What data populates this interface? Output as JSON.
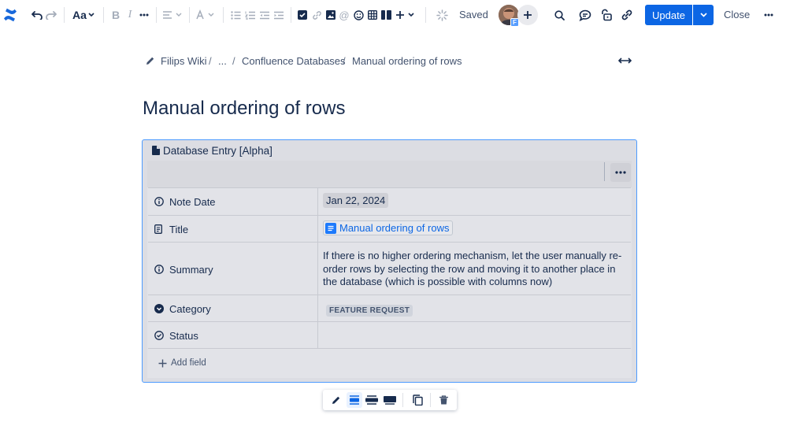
{
  "toolbar": {
    "text_style_label": "Aa",
    "saved_label": "Saved",
    "update_label": "Update",
    "close_label": "Close",
    "avatar_badge": "F"
  },
  "breadcrumb": {
    "items": [
      "Filips Wiki",
      "...",
      "Confluence Databases",
      "Manual ordering of rows"
    ]
  },
  "page": {
    "title": "Manual ordering of rows"
  },
  "database_entry": {
    "panel_title": "Database Entry [Alpha]",
    "rows": [
      {
        "label": "Note Date",
        "icon": "info-icon",
        "value": "Jan 22, 2024"
      },
      {
        "label": "Title",
        "icon": "page-icon",
        "value": "Manual ordering of rows"
      },
      {
        "label": "Summary",
        "icon": "info-icon",
        "value": "If there is no higher ordering mechanism, let the user manually re-order rows by selecting the row and moving it to another place in the database (which is possible with columns now)"
      },
      {
        "label": "Category",
        "icon": "dropdown-icon",
        "value": "FEATURE REQUEST"
      },
      {
        "label": "Status",
        "icon": "check-circle-icon",
        "value": ""
      }
    ],
    "add_field_label": "Add field"
  },
  "colors": {
    "accent": "#0c66e4",
    "panel_border": "#4c9aff",
    "panel_bg": "#dcdde3"
  }
}
